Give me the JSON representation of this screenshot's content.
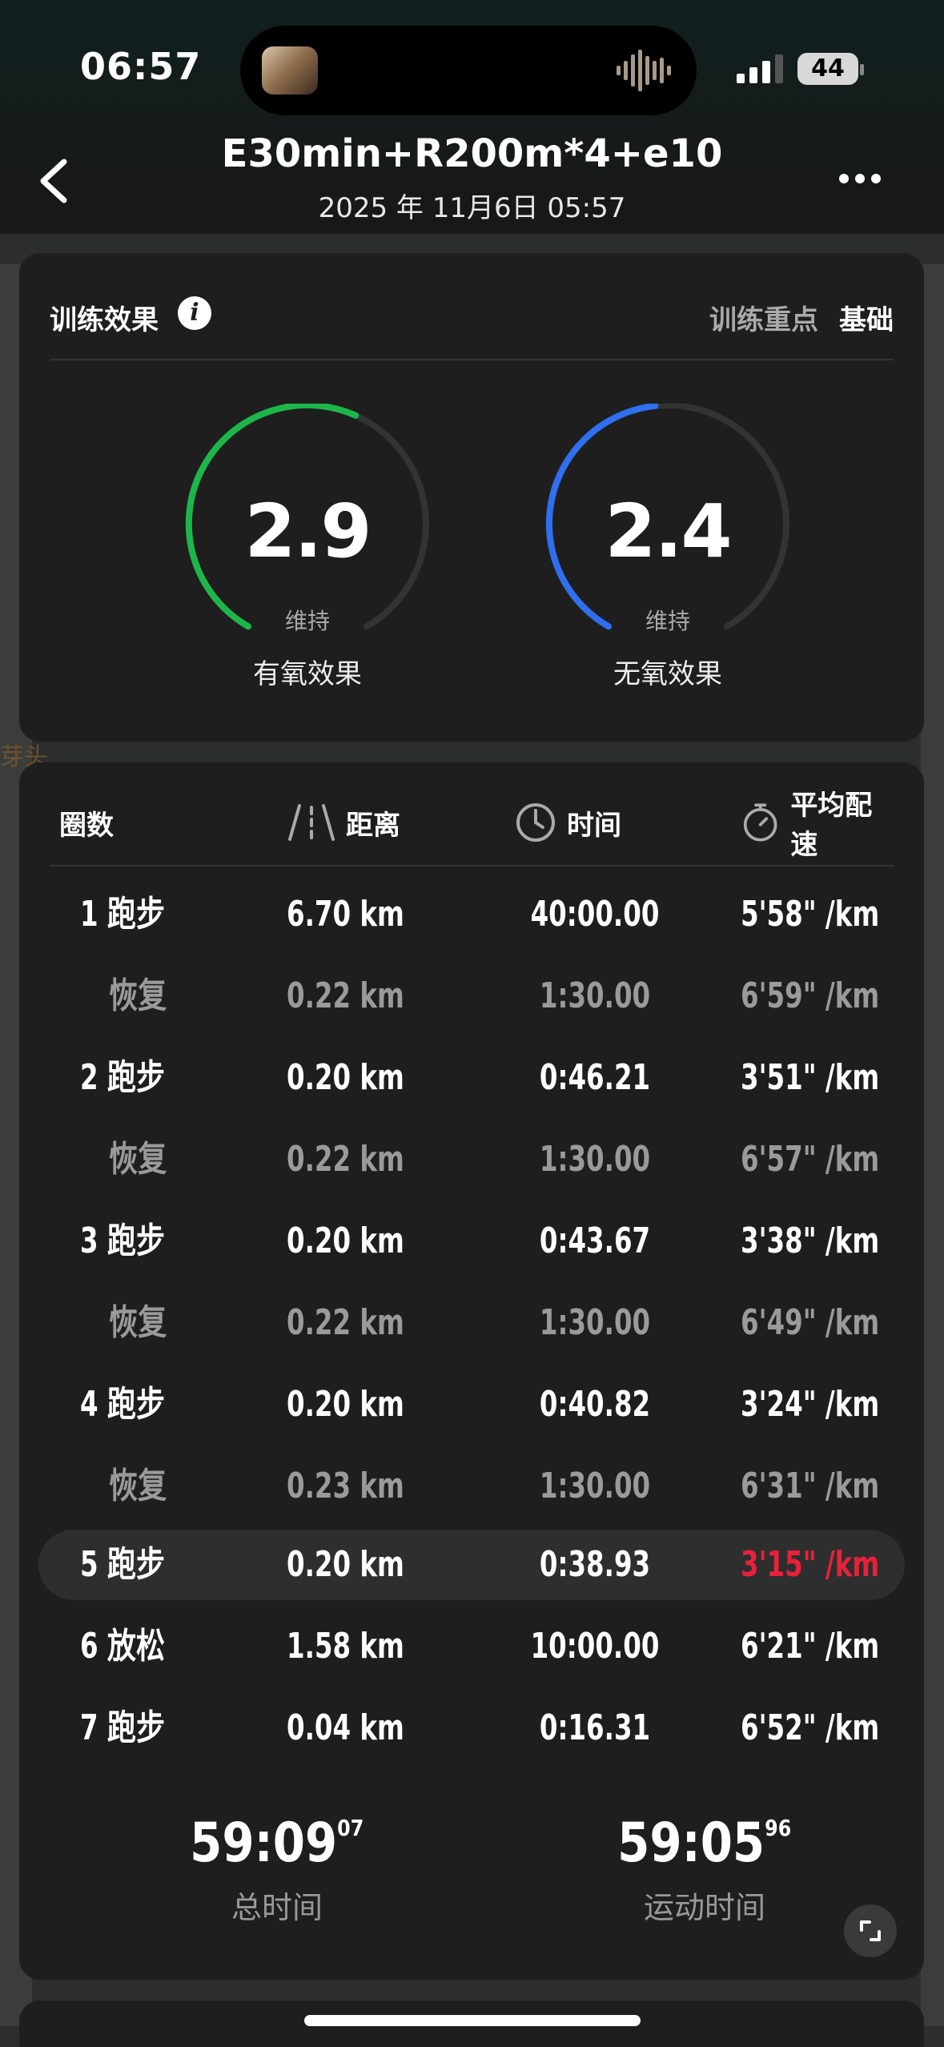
{
  "status_bar": {
    "time": "06:57",
    "battery": "44"
  },
  "header": {
    "title": "E30min+R200m*4+e10",
    "subtitle": "2025 年 11月6日 05:57"
  },
  "training_effect": {
    "title": "训练效果",
    "focus_label": "训练重点",
    "focus_value": "基础",
    "aerobic": {
      "value": "2.9",
      "status": "维持",
      "label": "有氧效果",
      "fraction": 0.58,
      "color": "#1db64a"
    },
    "anaerobic": {
      "value": "2.4",
      "status": "维持",
      "label": "无氧效果",
      "fraction": 0.48,
      "color": "#2f6ff0"
    }
  },
  "laps_table": {
    "headers": {
      "lap": "圈数",
      "distance": "距离",
      "time": "时间",
      "pace": "平均配速"
    },
    "rows": [
      {
        "lap": "1 跑步",
        "distance": "6.70 km",
        "time": "40:00.00",
        "pace": "5'58\" /km",
        "type": "run"
      },
      {
        "lap": "恢复",
        "distance": "0.22 km",
        "time": "1:30.00",
        "pace": "6'59\" /km",
        "type": "recovery"
      },
      {
        "lap": "2 跑步",
        "distance": "0.20 km",
        "time": "0:46.21",
        "pace": "3'51\" /km",
        "type": "run"
      },
      {
        "lap": "恢复",
        "distance": "0.22 km",
        "time": "1:30.00",
        "pace": "6'57\" /km",
        "type": "recovery"
      },
      {
        "lap": "3 跑步",
        "distance": "0.20 km",
        "time": "0:43.67",
        "pace": "3'38\" /km",
        "type": "run"
      },
      {
        "lap": "恢复",
        "distance": "0.22 km",
        "time": "1:30.00",
        "pace": "6'49\" /km",
        "type": "recovery"
      },
      {
        "lap": "4 跑步",
        "distance": "0.20 km",
        "time": "0:40.82",
        "pace": "3'24\" /km",
        "type": "run"
      },
      {
        "lap": "恢复",
        "distance": "0.23 km",
        "time": "1:30.00",
        "pace": "6'31\" /km",
        "type": "recovery"
      },
      {
        "lap": "5 跑步",
        "distance": "0.20 km",
        "time": "0:38.93",
        "pace": "3'15\" /km",
        "type": "highlight"
      },
      {
        "lap": "6 放松",
        "distance": "1.58 km",
        "time": "10:00.00",
        "pace": "6'21\" /km",
        "type": "run"
      },
      {
        "lap": "7 跑步",
        "distance": "0.04 km",
        "time": "0:16.31",
        "pace": "6'52\" /km",
        "type": "run"
      }
    ]
  },
  "totals": {
    "total_time": {
      "main": "59:09",
      "fraction": "07",
      "label": "总时间"
    },
    "moving_time": {
      "main": "59:05",
      "fraction": "96",
      "label": "运动时间"
    }
  },
  "colors": {
    "fastest_pace": "#e8213a",
    "aerobic": "#1db64a",
    "anaerobic": "#2f6ff0"
  }
}
